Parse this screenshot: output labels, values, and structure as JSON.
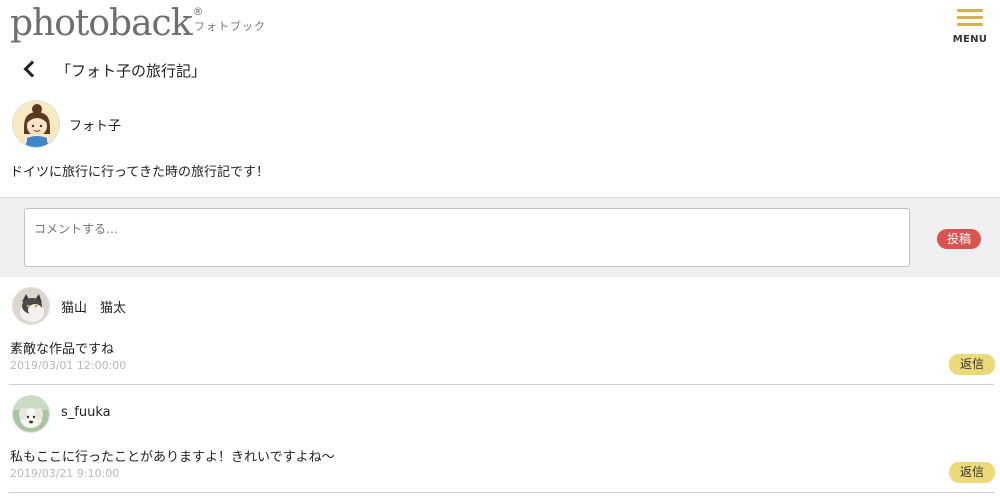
{
  "header": {
    "logo_main": "photoback",
    "logo_reg": "®",
    "logo_sub": "フォトブック",
    "menu_label": "MENU"
  },
  "page": {
    "title": "「フォト子の旅行記」"
  },
  "author": {
    "name": "フォト子"
  },
  "description": "ドイツに旅行に行ってきた時の旅行記です！",
  "comment_form": {
    "placeholder": "コメントする…",
    "post_label": "投稿"
  },
  "comments": [
    {
      "user": "猫山　猫太",
      "text": "素敵な作品ですね",
      "date": "2019/03/01 12:00:00",
      "reply_label": "返信"
    },
    {
      "user": "s_fuuka",
      "text": "私もここに行ったことがありますよ！きれいですよね～",
      "date": "2019/03/21 9:10:00",
      "reply_label": "返信"
    }
  ],
  "colors": {
    "menu_accent": "#d6b24c",
    "post_button": "#d9534f",
    "reply_button": "#ecd97a"
  }
}
